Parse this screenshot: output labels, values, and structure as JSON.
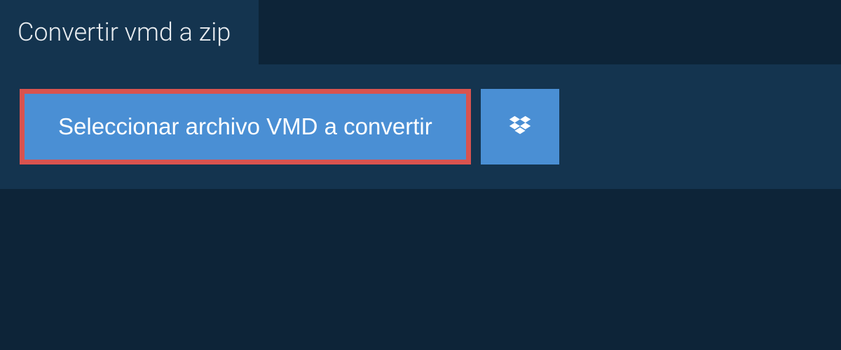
{
  "header": {
    "title": "Convertir vmd a zip"
  },
  "actions": {
    "select_file_label": "Seleccionar archivo VMD a convertir"
  },
  "colors": {
    "background": "#0d2438",
    "panel": "#14344f",
    "button": "#4a8fd4",
    "highlight_border": "#d9534f"
  }
}
